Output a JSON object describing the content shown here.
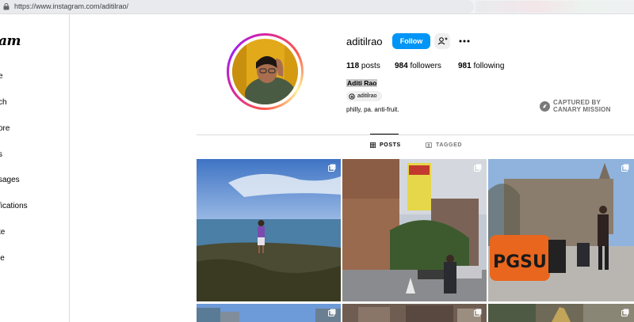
{
  "browser": {
    "url": "https://www.instagram.com/aditilrao/"
  },
  "sidebar": {
    "logo": "am",
    "items": [
      {
        "label": "e",
        "icon": "home-icon"
      },
      {
        "label": "ch",
        "icon": "search-icon"
      },
      {
        "label": "ore",
        "icon": "explore-icon"
      },
      {
        "label": "s",
        "icon": "reels-icon"
      },
      {
        "label": "sages",
        "icon": "messages-icon"
      },
      {
        "label": "fications",
        "icon": "notifications-icon"
      },
      {
        "label": "te",
        "icon": "create-icon"
      },
      {
        "label": "le",
        "icon": "profile-icon"
      }
    ]
  },
  "profile": {
    "username": "aditilrao",
    "follow_label": "Follow",
    "stats": {
      "posts_count": "118",
      "posts_label": "posts",
      "followers_count": "984",
      "followers_label": "followers",
      "following_count": "981",
      "following_label": "following"
    },
    "full_name": "Aditi Rao",
    "threads_handle": "aditilrao",
    "bio": "philly, pa. anti-fruit."
  },
  "watermark": {
    "line1": "CAPTURED BY",
    "line2": "CANARY MISSION"
  },
  "tabs": [
    {
      "label": "POSTS",
      "icon": "grid-icon",
      "active": true
    },
    {
      "label": "TAGGED",
      "icon": "tagged-icon",
      "active": false
    }
  ],
  "posts": [
    {
      "description": "beach-rocks",
      "multi": true
    },
    {
      "description": "street-sign",
      "multi": true
    },
    {
      "description": "pgsu-rally",
      "multi": true
    },
    {
      "description": "city-skyline",
      "multi": true
    },
    {
      "description": "building-street",
      "multi": true
    },
    {
      "description": "outdoor-statue",
      "multi": true
    }
  ],
  "photo_text": {
    "pgsu_sign": "PGSU"
  },
  "colors": {
    "accent": "#0095f6",
    "border": "#dbdbdb"
  }
}
